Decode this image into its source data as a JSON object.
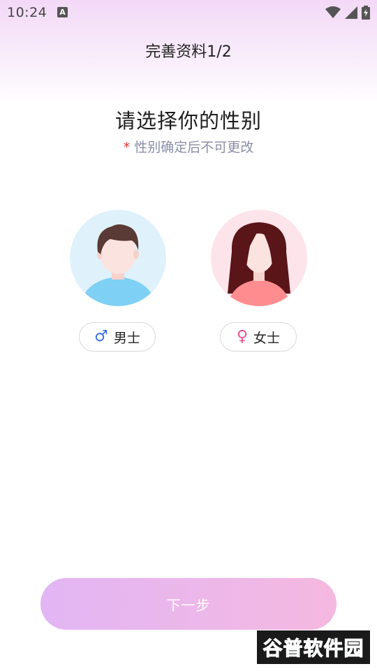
{
  "status_bar": {
    "time": "10:24",
    "notification_letter": "A"
  },
  "header": {
    "title": "完善资料1/2"
  },
  "prompt": {
    "heading": "请选择你的性别",
    "asterisk": "*",
    "note": "性别确定后不可更改"
  },
  "genders": [
    {
      "symbol": "♂",
      "label": "男士",
      "avatar_bg": "#dff2fb"
    },
    {
      "symbol": "♀",
      "label": "女士",
      "avatar_bg": "#fde4ea"
    }
  ],
  "next_button": {
    "label": "下一步"
  },
  "watermark": {
    "text": "谷普软件园"
  }
}
